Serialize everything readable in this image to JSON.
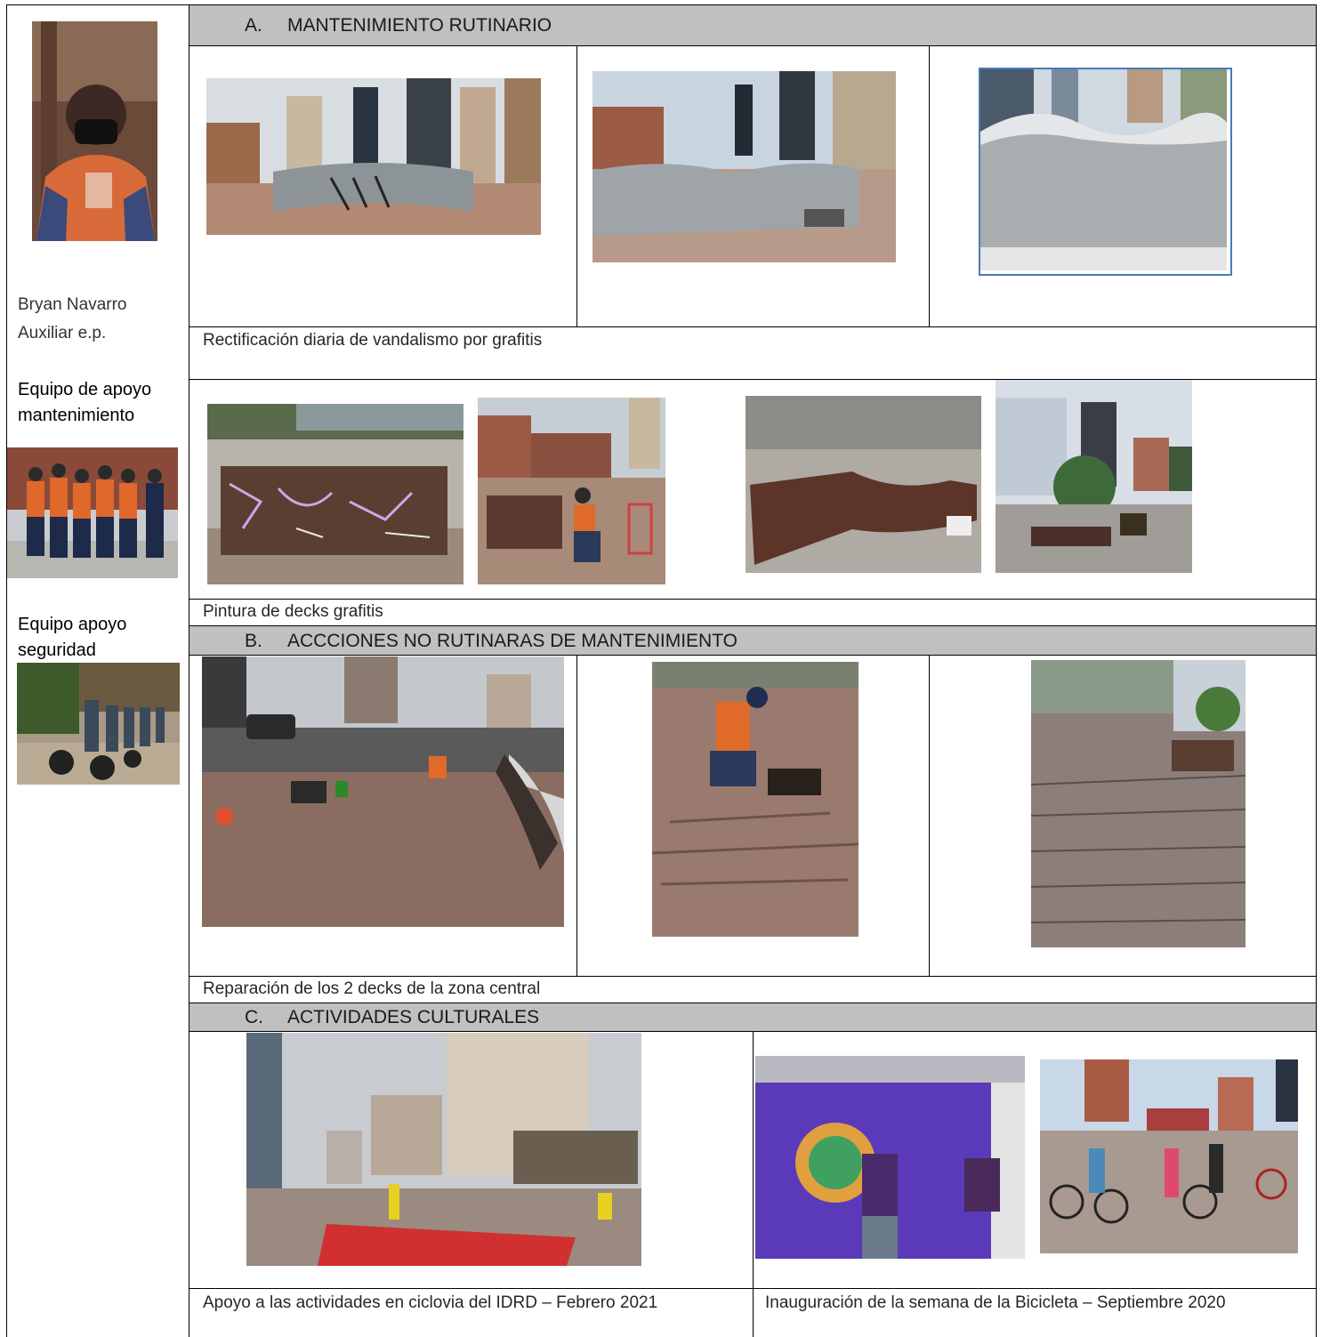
{
  "sidebar": {
    "person_name": "Bryan Navarro",
    "person_role": "Auxiliar e.p.",
    "team_maintenance_label": "Equipo de apoyo mantenimiento",
    "team_security_label": "Equipo apoyo seguridad"
  },
  "section_a": {
    "letter": "A.",
    "title": "MANTENIMIENTO RUTINARIO",
    "caption_1": "Rectificación diaria de vandalismo por grafitis",
    "caption_2": "Pintura de decks  grafitis"
  },
  "section_b": {
    "letter": "B.",
    "title": "ACCCIONES NO RUTINARAS DE MANTENIMIENTO",
    "caption": "Reparación de los 2 decks de la zona central"
  },
  "section_c": {
    "letter": "C.",
    "title": "ACTIVIDADES CULTURALES",
    "caption_left": "Apoyo a las actividades en ciclovia del IDRD – Febrero 2021",
    "caption_right": "Inauguración de la semana de la Bicicleta – Septiembre 2020"
  }
}
